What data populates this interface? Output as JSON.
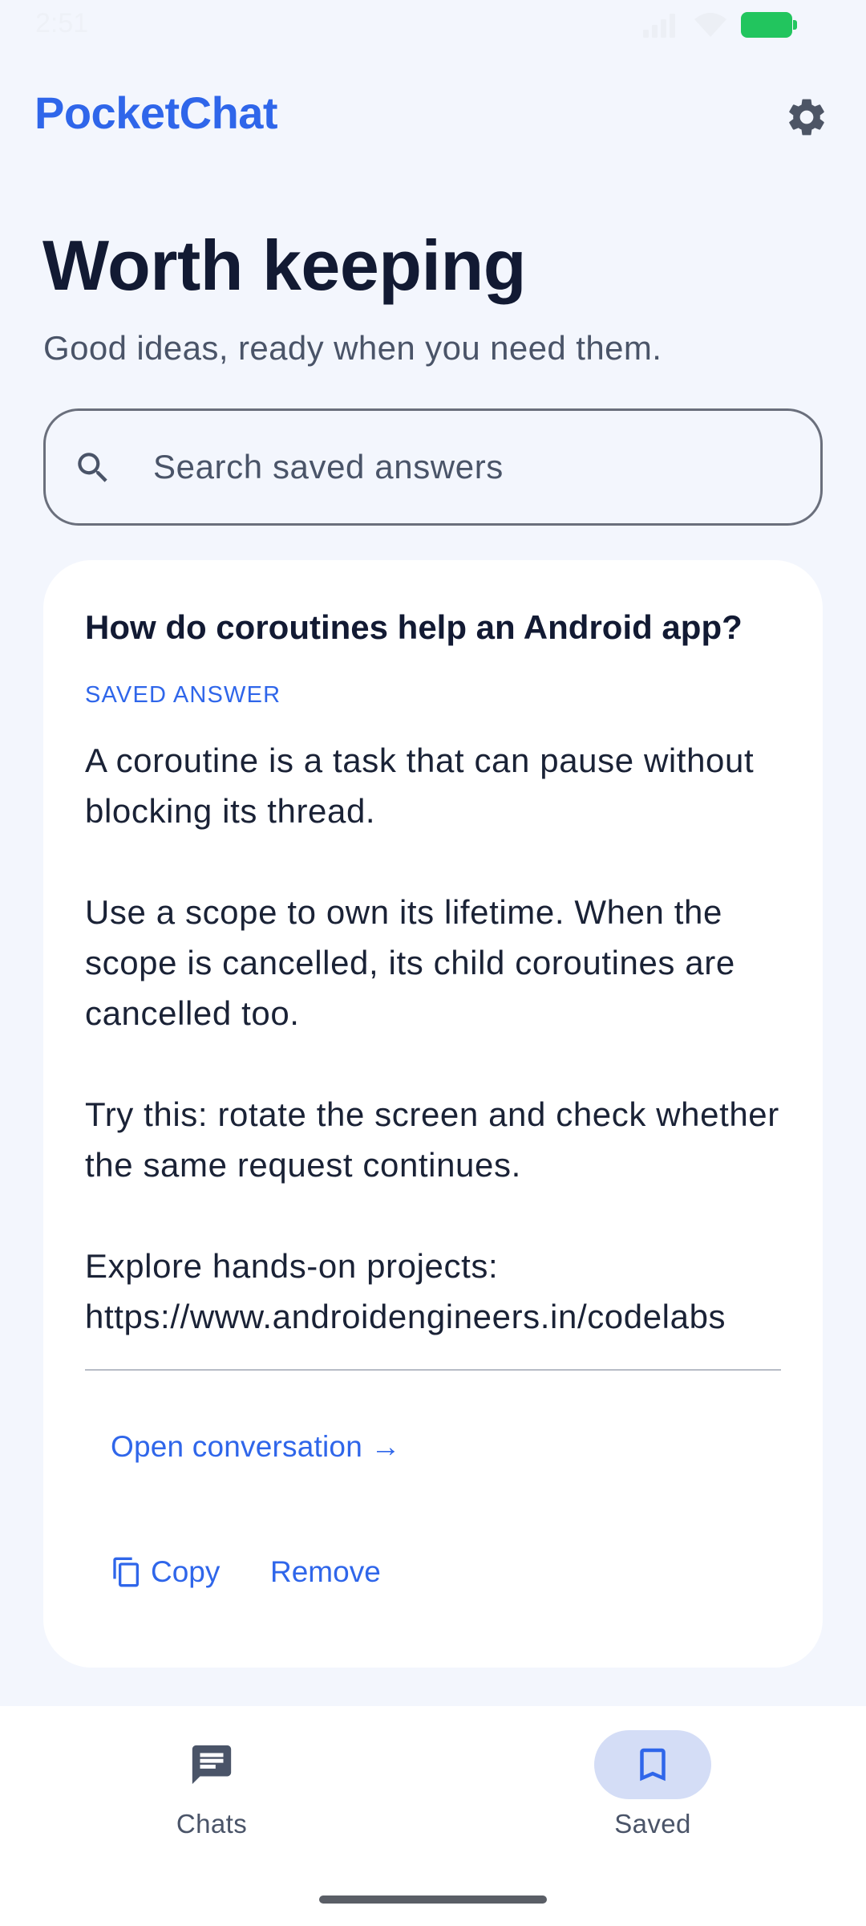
{
  "status_bar": {
    "time": "2:51"
  },
  "app_bar": {
    "title": "PocketChat",
    "settings_icon": "gear-icon"
  },
  "header": {
    "title": "Worth keeping",
    "subtitle": "Good ideas, ready when you need them."
  },
  "search": {
    "placeholder": "Search saved answers",
    "value": ""
  },
  "card": {
    "question": "How do coroutines help an Android app?",
    "label": "SAVED ANSWER",
    "paragraphs": [
      "A coroutine is a task that can pause without blocking its thread.",
      "Use a scope to own its lifetime. When the scope is cancelled, its child coroutines are cancelled too.",
      "Try this: rotate the screen and check whether the same request continues.",
      "Explore hands-on projects: https://www.androidengineers.in/codelabs"
    ],
    "open_link": "Open conversation →",
    "copy_label": "Copy",
    "remove_label": "Remove"
  },
  "bottom_nav": {
    "items": [
      {
        "label": "Chats",
        "icon": "chat-icon",
        "selected": false
      },
      {
        "label": "Saved",
        "icon": "bookmark-icon",
        "selected": true
      }
    ]
  },
  "colors": {
    "accent": "#2f66ea",
    "background": "#f3f6fd",
    "battery": "#22c55e",
    "nav_selected": "#d4ddf6"
  }
}
